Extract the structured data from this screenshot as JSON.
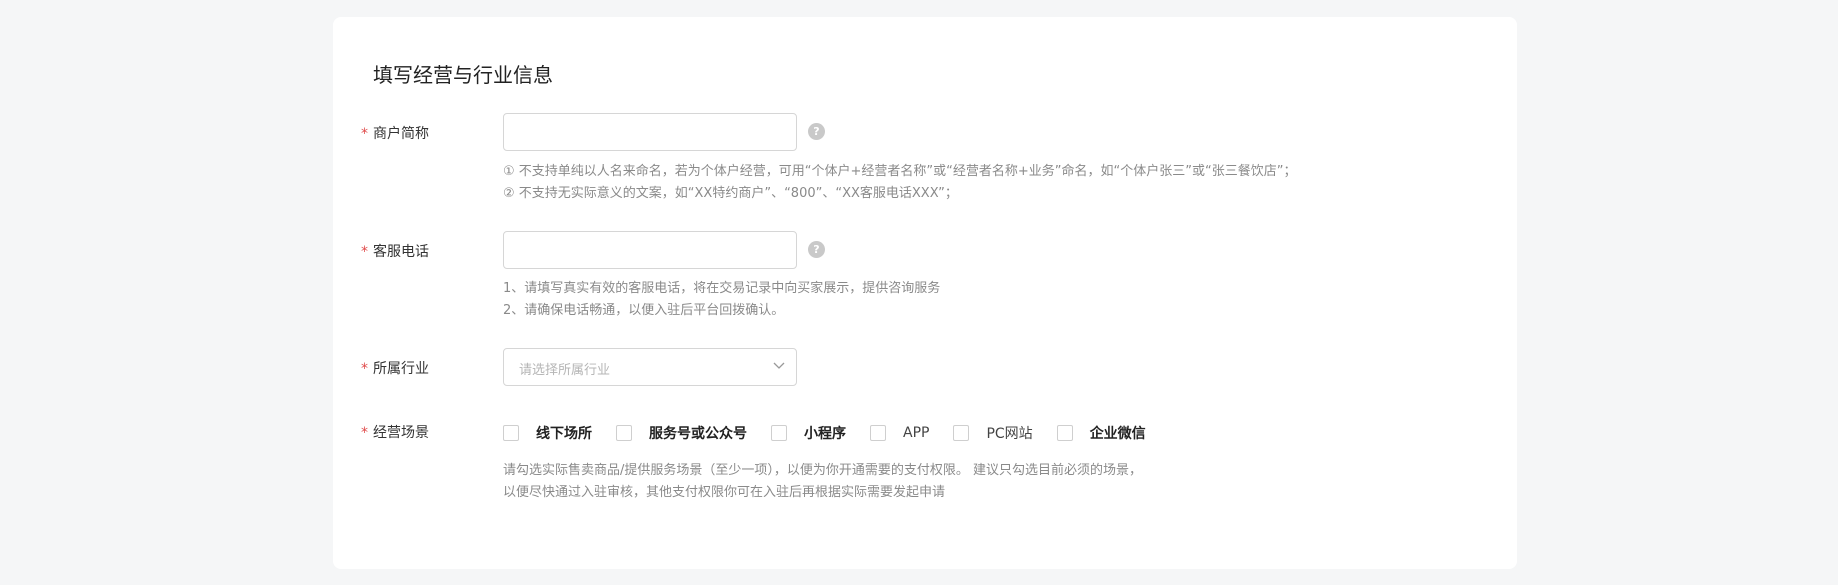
{
  "section_title": "填写经营与行业信息",
  "required_mark": "*",
  "merchant_name": {
    "label": "商户简称",
    "help_icon": "question-icon",
    "help_glyph": "?",
    "hints": [
      "① 不支持单纯以人名来命名，若为个体户经营，可用“个体户+经营者名称”或“经营者名称+业务”命名，如“个体户张三”或“张三餐饮店”；",
      "② 不支持无实际意义的文案，如“XX特约商户”、“800”、“XX客服电话XXX”；"
    ]
  },
  "service_phone": {
    "label": "客服电话",
    "help_icon": "question-icon",
    "help_glyph": "?",
    "hints": [
      "1、请填写真实有效的客服电话，将在交易记录中向买家展示，提供咨询服务",
      "2、请确保电话畅通，以便入驻后平台回拨确认。"
    ]
  },
  "industry": {
    "label": "所属行业",
    "placeholder": "请选择所属行业"
  },
  "scenes": {
    "label": "经营场景",
    "options": [
      "线下场所",
      "服务号或公众号",
      "小程序",
      "APP",
      "PC网站",
      "企业微信"
    ],
    "hints": [
      "请勾选实际售卖商品/提供服务场景（至少一项），以便为你开通需要的支付权限。 建议只勾选目前必须的场景，",
      "以便尽快通过入驻审核，其他支付权限你可在入驻后再根据实际需要发起申请"
    ]
  }
}
